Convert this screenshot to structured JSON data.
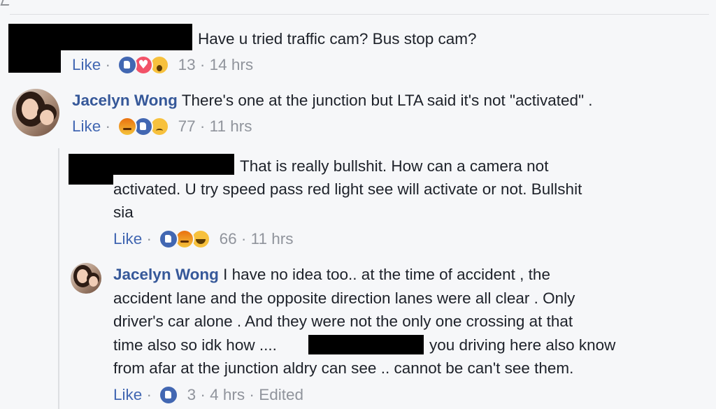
{
  "comments": [
    {
      "author": "",
      "text": "Have u tried traffic cam? Bus stop cam?",
      "like_label": "Like",
      "reactions": [
        "like-icon",
        "love-icon",
        "wow-icon"
      ],
      "reaction_count": "13",
      "time": "14 hrs"
    },
    {
      "author": "Jacelyn Wong",
      "text": "There's one at the junction but LTA said it's not \"activated\" .",
      "like_label": "Like",
      "reactions": [
        "angry-icon",
        "like-icon",
        "sad-icon"
      ],
      "reaction_count": "77",
      "time": "11 hrs"
    }
  ],
  "replies": [
    {
      "author": "",
      "text_line1": "That is really bullshit. How can a camera not",
      "text_line2": "activated. U try speed pass red light see will activate or not. Bullshit",
      "text_line3": "sia",
      "like_label": "Like",
      "reactions": [
        "like-icon",
        "angry-icon",
        "haha-icon"
      ],
      "reaction_count": "66",
      "time": "11 hrs"
    },
    {
      "author": "Jacelyn Wong",
      "text_line1": "I have no idea too.. at the time of accident , the",
      "text_line2": "accident lane and the opposite direction lanes were all clear . Only",
      "text_line3": "driver's car alone . And they were not the only one crossing at that",
      "text_line4a": "time also so idk how ....",
      "text_line4b": "you driving here also know",
      "text_line5": "from afar at the junction aldry can see .. cannot be can't see them.",
      "like_label": "Like",
      "reactions": [
        "like-icon"
      ],
      "reaction_count": "3",
      "time": "4 hrs",
      "edited": "Edited"
    }
  ],
  "separator": "·",
  "colors": {
    "link": "#4267b2",
    "name": "#365899",
    "meta": "#90949c",
    "background": "#f6f7f9"
  }
}
